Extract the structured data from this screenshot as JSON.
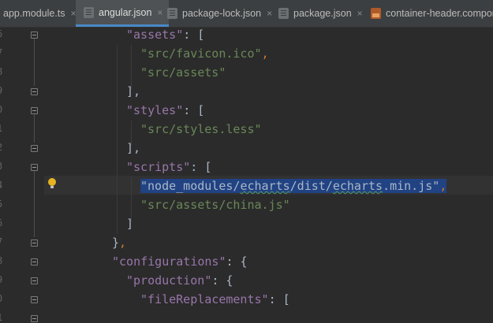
{
  "tabs": [
    {
      "label": "app.module.ts",
      "icon": "ts-file-icon",
      "active": false
    },
    {
      "label": "angular.json",
      "icon": "json-file-icon",
      "active": true
    },
    {
      "label": "package-lock.json",
      "icon": "json-file-icon",
      "active": false
    },
    {
      "label": "package.json",
      "icon": "json-file-icon",
      "active": false
    },
    {
      "label": "container-header.componen",
      "icon": "html-file-icon",
      "active": false
    }
  ],
  "close_glyph": "×",
  "line_numbers": [
    "6",
    "7",
    "8",
    "9",
    "0",
    "1",
    "2",
    "3",
    "4",
    "5",
    "6",
    "7",
    "8",
    "9",
    "0",
    "1"
  ],
  "code": {
    "l1_key": "\"assets\"",
    "l1_rest": ": [",
    "l2_str": "\"src/favicon.ico\"",
    "l2_comma": ",",
    "l3_str": "\"src/assets\"",
    "l4_close": "],",
    "l5_key": "\"styles\"",
    "l5_rest": ": [",
    "l6_str": "\"src/styles.less\"",
    "l7_close": "],",
    "l8_key": "\"scripts\"",
    "l8_rest": ": [",
    "l9_a": "\"node_modules/",
    "l9_b": "echarts",
    "l9_c": "/dist/",
    "l9_d": "echarts",
    "l9_e": ".min.js\"",
    "l9_comma": ",",
    "l10_str": "\"src/assets/china.js\"",
    "l11_close": "]",
    "l12_brace": "}",
    "l12_comma": ",",
    "l13_key": "\"configurations\"",
    "l13_rest": ": {",
    "l14_key": "\"production\"",
    "l14_rest": ": {",
    "l15_key": "\"fileReplacements\"",
    "l15_rest": ": ["
  },
  "colors": {
    "background": "#2b2b2b",
    "key": "#9876aa",
    "string": "#6a8759",
    "punctuation": "#a9b7c6",
    "comma": "#cc7832",
    "selection": "#214283",
    "tab_accent": "#4a88c7"
  }
}
